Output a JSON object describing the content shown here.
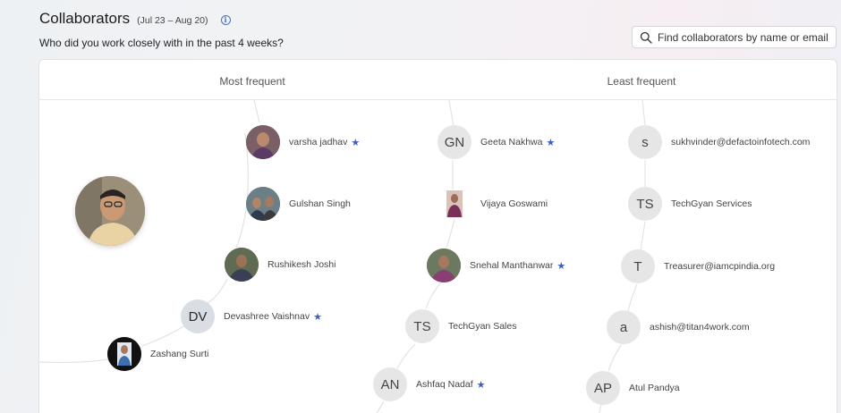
{
  "header": {
    "title": "Collaborators",
    "range": "(Jul 23 – Aug 20)",
    "subtitle": "Who did you work closely with in the past 4 weeks?",
    "info_glyph": "i"
  },
  "search": {
    "placeholder": "Find collaborators by name or email"
  },
  "columns": {
    "most": "Most frequent",
    "least": "Least frequent"
  },
  "star_glyph": "★",
  "colors": {
    "accent": "#3b5fc4",
    "line": "#e3e3e3",
    "avatar_bg": "#e6e6e6"
  },
  "people": [
    {
      "id": "varsha",
      "name": "varsha jadhav",
      "initials": "",
      "photo": true,
      "favorite": true
    },
    {
      "id": "gulshan",
      "name": "Gulshan Singh",
      "initials": "",
      "photo": true,
      "favorite": false
    },
    {
      "id": "rushikesh",
      "name": "Rushikesh Joshi",
      "initials": "",
      "photo": true,
      "favorite": false
    },
    {
      "id": "devashree",
      "name": "Devashree Vaishnav",
      "initials": "DV",
      "photo": false,
      "favorite": true
    },
    {
      "id": "zashang",
      "name": "Zashang Surti",
      "initials": "",
      "photo": true,
      "favorite": false
    },
    {
      "id": "geeta",
      "name": "Geeta Nakhwa",
      "initials": "GN",
      "photo": false,
      "favorite": true
    },
    {
      "id": "vijaya",
      "name": "Vijaya Goswami",
      "initials": "",
      "photo": true,
      "favorite": false
    },
    {
      "id": "snehal",
      "name": "Snehal Manthanwar",
      "initials": "",
      "photo": true,
      "favorite": true
    },
    {
      "id": "tgsales",
      "name": "TechGyan Sales",
      "initials": "TS",
      "photo": false,
      "favorite": false
    },
    {
      "id": "ashfaq",
      "name": "Ashfaq Nadaf",
      "initials": "AN",
      "photo": false,
      "favorite": true
    },
    {
      "id": "sukh",
      "name": "sukhvinder@defactoinfotech.com",
      "initials": "s",
      "photo": false,
      "favorite": false
    },
    {
      "id": "tgserv",
      "name": "TechGyan Services",
      "initials": "TS",
      "photo": false,
      "favorite": false
    },
    {
      "id": "treas",
      "name": "Treasurer@iamcpindia.org",
      "initials": "T",
      "photo": false,
      "favorite": false
    },
    {
      "id": "ashish",
      "name": "ashish@titan4work.com",
      "initials": "a",
      "photo": false,
      "favorite": false
    },
    {
      "id": "atul",
      "name": "Atul Pandya",
      "initials": "AP",
      "photo": false,
      "favorite": false
    }
  ]
}
